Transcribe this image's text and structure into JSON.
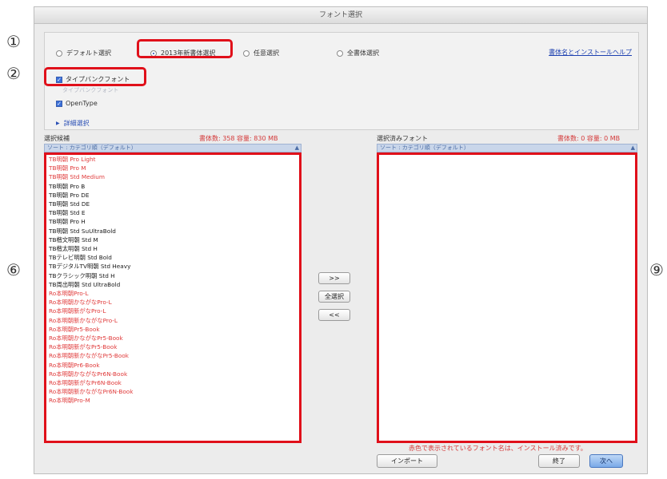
{
  "window": {
    "title": "フォント選択"
  },
  "markers": [
    "①",
    "②",
    "⑥",
    "⑨"
  ],
  "selection_mode": {
    "options": [
      {
        "label": "デフォルト選択",
        "selected": false
      },
      {
        "label": "2013年新書体選択",
        "selected": true
      },
      {
        "label": "任意選択",
        "selected": false
      },
      {
        "label": "全書体選択",
        "selected": false
      }
    ],
    "help_link": "書体名とインストールヘルプ"
  },
  "filters": {
    "typebank": {
      "label": "タイプバンクフォント",
      "checked": true
    },
    "faint_subtext": "タイプバンクフォント",
    "opentype": {
      "label": "OpenType",
      "checked": true
    },
    "detail_label": "詳細選択",
    "detail_icon": "triangle-right-icon"
  },
  "candidates": {
    "heading": "選択候補",
    "stats": "書体数: 358 容量: 830 MB",
    "sort_label": "ソート : カテゴリ順（デフォルト）",
    "items": [
      {
        "name": "TB明朝 Pro Light",
        "installed": true
      },
      {
        "name": "TB明朝 Pro M",
        "installed": true
      },
      {
        "name": "TB明朝 Std Medium",
        "installed": true
      },
      {
        "name": "TB明朝 Pro B",
        "installed": false
      },
      {
        "name": "TB明朝 Pro DE",
        "installed": false
      },
      {
        "name": "TB明朝 Std DE",
        "installed": false
      },
      {
        "name": "TB明朝 Std E",
        "installed": false
      },
      {
        "name": "TB明朝 Pro H",
        "installed": false
      },
      {
        "name": "TB明朝 Std SuUltraBold",
        "installed": false
      },
      {
        "name": "TB楷文明朝 Std M",
        "installed": false
      },
      {
        "name": "TB楷太明朝 Std H",
        "installed": false
      },
      {
        "name": "TBテレビ明朝 Std Bold",
        "installed": false
      },
      {
        "name": "TBデジタルTV明朝 Std Heavy",
        "installed": false
      },
      {
        "name": "TBクラシック明朝 Std H",
        "installed": false
      },
      {
        "name": "TB周出明朝 Std UltraBold",
        "installed": false
      },
      {
        "name": "Ro本明朝Pro-L",
        "installed": true
      },
      {
        "name": "Ro本明朝かながなPro-L",
        "installed": true
      },
      {
        "name": "Ro本明朝新がなPro-L",
        "installed": true
      },
      {
        "name": "Ro本明朝新かながなPro-L",
        "installed": true
      },
      {
        "name": "Ro本明朝Pr5-Book",
        "installed": true
      },
      {
        "name": "Ro本明朝かながなPr5-Book",
        "installed": true
      },
      {
        "name": "Ro本明朝新がなPr5-Book",
        "installed": true
      },
      {
        "name": "Ro本明朝新かながなPr5-Book",
        "installed": true
      },
      {
        "name": "Ro本明朝Pr6-Book",
        "installed": true
      },
      {
        "name": "Ro本明朝かながなPr6N-Book",
        "installed": true
      },
      {
        "name": "Ro本明朝新がなPr6N-Book",
        "installed": true
      },
      {
        "name": "Ro本明朝新かながなPr6N-Book",
        "installed": true
      },
      {
        "name": "Ro本明朝Pro-M",
        "installed": true
      }
    ]
  },
  "selected": {
    "heading": "選択済みフォント",
    "stats": "書体数: 0 容量: 0 MB",
    "sort_label": "ソート : カテゴリ順（デフォルト）",
    "items": []
  },
  "transfer": {
    "add": ">>",
    "select_all": "全選択",
    "remove": "<<"
  },
  "footer": {
    "note": "赤色で表示されているフォント名は、インストール済みです。",
    "import_button": "インポート",
    "finish_button": "終了",
    "next_button": "次へ"
  },
  "colors": {
    "highlight": "#e0101a",
    "installed": "#e03a3a",
    "link": "#1b3fb0"
  }
}
